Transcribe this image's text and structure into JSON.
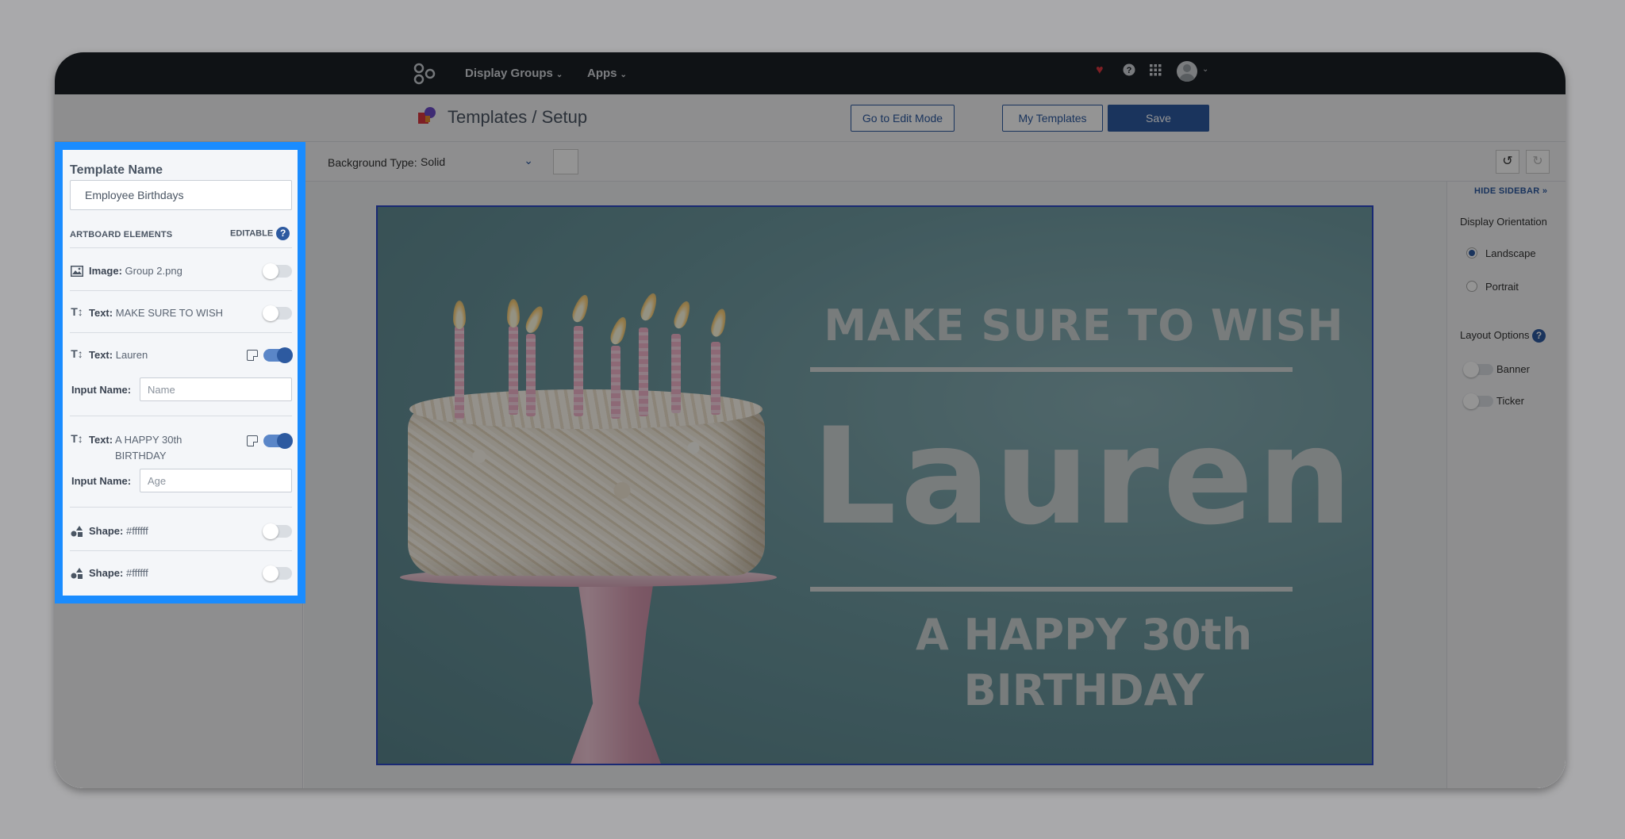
{
  "nav": {
    "menus": [
      {
        "label": "Display Groups"
      },
      {
        "label": "Apps"
      }
    ]
  },
  "header": {
    "breadcrumb": "Templates / Setup",
    "edit_mode_label": "Go to Edit Mode",
    "my_templates_label": "My Templates",
    "save_label": "Save"
  },
  "toolbar": {
    "bg_type_label": "Background Type:",
    "bg_type_value": "Solid"
  },
  "artboard": {
    "line1": "MAKE SURE TO WISH",
    "name": "Lauren",
    "line3a": "A HAPPY 30th",
    "line3b": "BIRTHDAY"
  },
  "right_sidebar": {
    "hide_label": "HIDE SIDEBAR",
    "orientation_heading": "Display Orientation",
    "landscape": "Landscape",
    "portrait": "Portrait",
    "layout_heading": "Layout Options",
    "banner": "Banner",
    "ticker": "Ticker"
  },
  "panel": {
    "template_name_label": "Template Name",
    "template_name_value": "Employee Birthdays",
    "elements_heading": "ARTBOARD ELEMENTS",
    "editable_heading": "EDITABLE",
    "rows": [
      {
        "type": "Image:",
        "value": "Group 2.png"
      },
      {
        "type": "Text:",
        "value": "MAKE SURE TO WISH"
      },
      {
        "type": "Text:",
        "value": "Lauren"
      },
      {
        "type": "Text:",
        "value": "A HAPPY 30th"
      },
      {
        "type": "Shape:",
        "value": "#ffffff"
      },
      {
        "type": "Shape:",
        "value": "#ffffff"
      }
    ],
    "row4_value_line2": "BIRTHDAY",
    "input_name_label": "Input Name:",
    "input_name_placeholder_1": "Name",
    "input_name_placeholder_2": "Age"
  },
  "colors": {
    "accent": "#2d5aa0",
    "highlight": "#1a8cff",
    "nav_bg": "#1b1f25",
    "artboard_bg": "#6e9aa1"
  }
}
